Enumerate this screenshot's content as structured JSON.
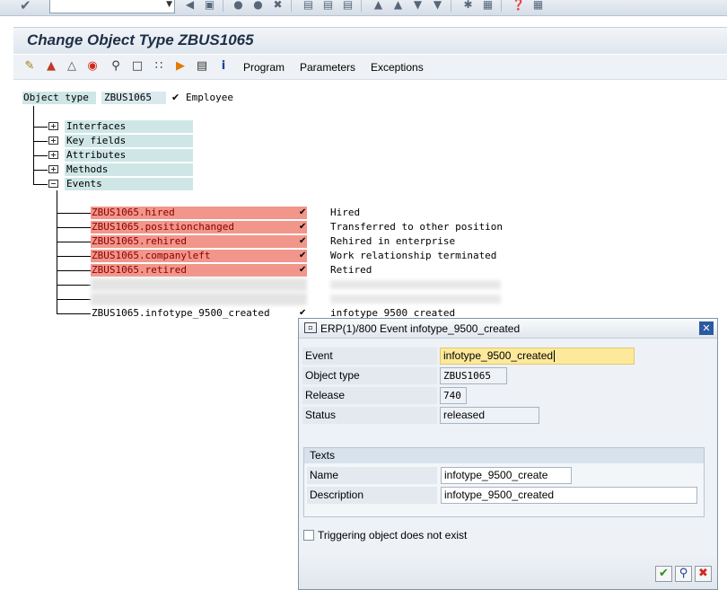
{
  "window": {
    "title": "Change Object Type ZBUS1065"
  },
  "app_toolbar": {
    "menus": [
      "Program",
      "Parameters",
      "Exceptions"
    ]
  },
  "tree": {
    "object_type_label": "Object type",
    "object_type_value": "ZBUS1065",
    "object_type_desc": "Employee",
    "nodes": [
      "Interfaces",
      "Key fields",
      "Attributes",
      "Methods",
      "Events"
    ],
    "events": [
      {
        "name": "ZBUS1065.hired",
        "desc": "Hired"
      },
      {
        "name": "ZBUS1065.positionchanged",
        "desc": "Transferred to other position"
      },
      {
        "name": "ZBUS1065.rehired",
        "desc": "Rehired in enterprise"
      },
      {
        "name": "ZBUS1065.companyleft",
        "desc": "Work relationship terminated"
      },
      {
        "name": "ZBUS1065.retired",
        "desc": "Retired"
      },
      {
        "name": "ZBUS1065.infotype_9500_created",
        "desc": "infotype 9500 created"
      }
    ]
  },
  "dialog": {
    "title": "ERP(1)/800 Event infotype_9500_created",
    "event_label": "Event",
    "event_value": "infotype_9500_created",
    "object_type_label": "Object type",
    "object_type_value": "ZBUS1065",
    "release_label": "Release",
    "release_value": "740",
    "status_label": "Status",
    "status_value": "released",
    "texts_title": "Texts",
    "name_label": "Name",
    "name_value": "infotype_9500_create",
    "description_label": "Description",
    "description_value": "infotype_9500_created",
    "checkbox_label": "Triggering object does not exist"
  },
  "colors": {
    "event_highlight": "#f2958a",
    "tree_label_bg": "#cfe6e6",
    "input_highlight": "#fde99b",
    "close_button": "#2c5aa0"
  }
}
